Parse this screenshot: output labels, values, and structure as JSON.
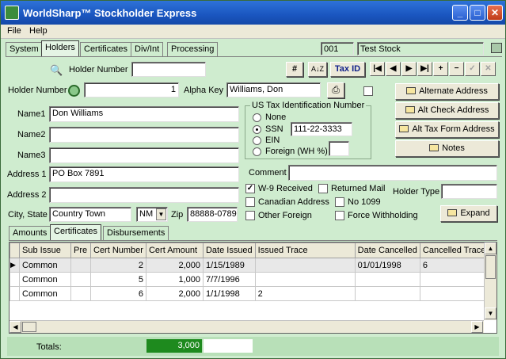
{
  "window": {
    "title": "WorldSharp™ Stockholder Express",
    "minimize": "_",
    "maximize": "□",
    "close": "✕"
  },
  "menu": [
    "File",
    "Help"
  ],
  "main_tabs": [
    "System",
    "Holders",
    "Certificates",
    "Div/Int",
    "Processing"
  ],
  "company": {
    "code": "001",
    "name": "Test Stock"
  },
  "search": {
    "label": "Holder Number",
    "value": "",
    "hash_label": "#",
    "sort_label": "A↓Z",
    "taxid_label": "Tax ID"
  },
  "nav_buttons": [
    "|◀",
    "◀",
    "▶",
    "▶|",
    "+",
    "−",
    "✓",
    "✕"
  ],
  "holder": {
    "number_label": "Holder Number",
    "number": "1",
    "alpha_key_label": "Alpha Key",
    "alpha_key": "Williams, Don",
    "name1_label": "Name1",
    "name1": "Don Williams",
    "name2_label": "Name2",
    "name2": "",
    "name3_label": "Name3",
    "name3": "",
    "address1_label": "Address 1",
    "address1": "PO Box 7891",
    "address2_label": "Address 2",
    "address2": "",
    "citystate_label": "City, State",
    "city": "Country Town",
    "state": "NM",
    "zip_label": "Zip",
    "zip": "88888-0789"
  },
  "tax_id": {
    "group_title": "US Tax Identification Number",
    "options": [
      "None",
      "SSN",
      "EIN",
      "Foreign (WH %)"
    ],
    "selected": "SSN",
    "ssn": "111-22-3333",
    "wh_pct": ""
  },
  "side_buttons": [
    "Alternate Address",
    "Alt Check Address",
    "Alt Tax Form Address",
    "Notes"
  ],
  "comment_label": "Comment",
  "comment": "",
  "checks": [
    {
      "label": "W-9 Received",
      "checked": true
    },
    {
      "label": "Returned Mail",
      "checked": false
    },
    {
      "label": "Canadian Address",
      "checked": false
    },
    {
      "label": "No 1099",
      "checked": false
    },
    {
      "label": "Other Foreign",
      "checked": false
    },
    {
      "label": "Force Withholding",
      "checked": false
    }
  ],
  "holder_type_label": "Holder Type",
  "holder_type": "",
  "expand_label": "Expand",
  "sub_tabs": [
    "Amounts",
    "Certificates",
    "Disbursements"
  ],
  "grid": {
    "columns": [
      "Sub Issue",
      "Pre",
      "Cert Number",
      "Cert Amount",
      "Date Issued",
      "Issued Trace",
      "Date Cancelled",
      "Cancelled Trace"
    ],
    "rows": [
      [
        "Common",
        "",
        "2",
        "2,000",
        "1/15/1989",
        "",
        "01/01/1998",
        "6"
      ],
      [
        "Common",
        "",
        "5",
        "1,000",
        "7/7/1996",
        "",
        "",
        ""
      ],
      [
        "Common",
        "",
        "6",
        "2,000",
        "1/1/1998",
        "2",
        "",
        ""
      ]
    ]
  },
  "totals": {
    "label": "Totals:",
    "value": "3,000"
  },
  "colors": {
    "accent_green": "#1e8a1e",
    "window_bg": "#cfeccf",
    "titlebar_blue": "#1a56c0"
  }
}
